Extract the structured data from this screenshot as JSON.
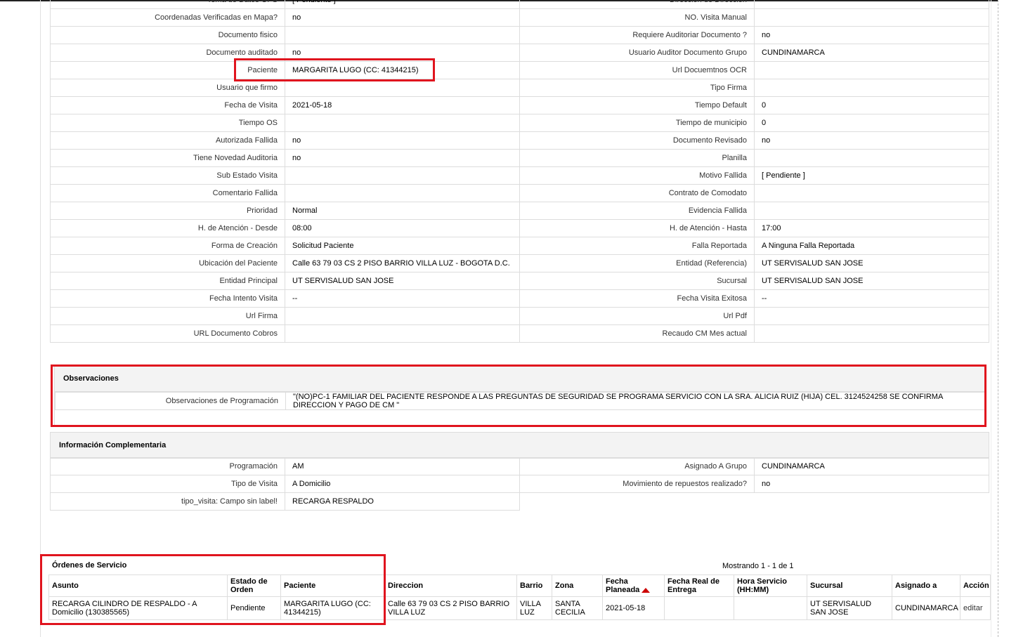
{
  "details": [
    [
      "Tema de Datos GPS",
      "[ Pendiente ]",
      "Dirección de Dirección",
      ""
    ],
    [
      "Coordenadas Verificadas en Mapa?",
      "no",
      "NO. Visita Manual",
      ""
    ],
    [
      "Documento fisico",
      "",
      "Requiere Auditoriar Documento ?",
      "no"
    ],
    [
      "Documento auditado",
      "no",
      "Usuario Auditor Documento Grupo",
      "CUNDINAMARCA"
    ],
    [
      "Paciente",
      "MARGARITA LUGO (CC: 41344215)",
      "Url Docuemtnos OCR",
      ""
    ],
    [
      "Usuario que firmo",
      "",
      "Tipo Firma",
      ""
    ],
    [
      "Fecha de Visita",
      "2021-05-18",
      "Tiempo Default",
      "0"
    ],
    [
      "Tiempo OS",
      "",
      "Tiempo de municipio",
      "0"
    ],
    [
      "Autorizada Fallida",
      "no",
      "Documento Revisado",
      "no"
    ],
    [
      "Tiene Novedad Auditoria",
      "no",
      "Planilla",
      ""
    ],
    [
      "Sub Estado Visita",
      "",
      "Motivo Fallida",
      "[ Pendiente ]"
    ],
    [
      "Comentario Fallida",
      "",
      "Contrato de Comodato",
      ""
    ],
    [
      "Prioridad",
      "Normal",
      "Evidencia Fallida",
      ""
    ],
    [
      "H. de Atención - Desde",
      "08:00",
      "H. de Atención - Hasta",
      "17:00"
    ],
    [
      "Forma de Creación",
      "Solicitud Paciente",
      "Falla Reportada",
      "A Ninguna Falla Reportada"
    ],
    [
      "Ubicación del Paciente",
      "Calle 63 79 03 CS 2 PISO BARRIO VILLA LUZ - BOGOTA D.C.",
      "Entidad (Referencia)",
      "UT SERVISALUD SAN JOSE"
    ],
    [
      "Entidad Principal",
      "UT SERVISALUD SAN JOSE",
      "Sucursal",
      "UT SERVISALUD SAN JOSE"
    ],
    [
      "Fecha Intento Visita",
      "--",
      "Fecha Visita Exitosa",
      "--"
    ],
    [
      "Url Firma",
      "",
      "Url Pdf",
      ""
    ],
    [
      "URL Documento Cobros",
      "",
      "Recaudo CM Mes actual",
      ""
    ]
  ],
  "observaciones": {
    "title": "Observaciones",
    "label": "Observaciones de Programación",
    "value": "\"(NO)PC-1 FAMILIAR DEL PACIENTE RESPONDE A LAS PREGUNTAS DE SEGURIDAD SE PROGRAMA SERVICIO CON LA SRA. ALICIA RUIZ (HIJA) CEL. 3124524258 SE CONFIRMA DIRECCION Y PAGO DE CM \""
  },
  "info": {
    "title": "Información Complementaria",
    "rows": [
      [
        "Programación",
        "AM",
        "Asignado A Grupo",
        "CUNDINAMARCA"
      ],
      [
        "Tipo de Visita",
        "A Domicilio",
        "Movimiento de repuestos realizado?",
        "no"
      ]
    ],
    "last": [
      "tipo_visita: Campo sin label!",
      "RECARGA RESPALDO"
    ]
  },
  "orders": {
    "title": "Órdenes de Servicio",
    "showing": "Mostrando 1 - 1 de 1",
    "columns": [
      "Asunto",
      "Estado de Orden",
      "Paciente",
      "Direccion",
      "Barrio",
      "Zona",
      "Fecha Planeada",
      "Fecha Real de Entrega",
      "Hora Servicio (HH:MM)",
      "Sucursal",
      "Asignado a",
      "Acción"
    ],
    "rows": [
      [
        "RECARGA CILINDRO DE RESPALDO - A Domicilio (130385565)",
        "Pendiente",
        "MARGARITA LUGO (CC: 41344215)",
        "Calle 63 79 03 CS 2 PISO BARRIO VILLA LUZ",
        "VILLA LUZ",
        "SANTA CECILIA",
        "2021-05-18",
        "",
        "",
        "UT SERVISALUD SAN JOSE",
        "CUNDINAMARCA",
        "editar"
      ]
    ]
  },
  "colors": {
    "highlight": "#e0141e",
    "sort": "#cc0000"
  }
}
